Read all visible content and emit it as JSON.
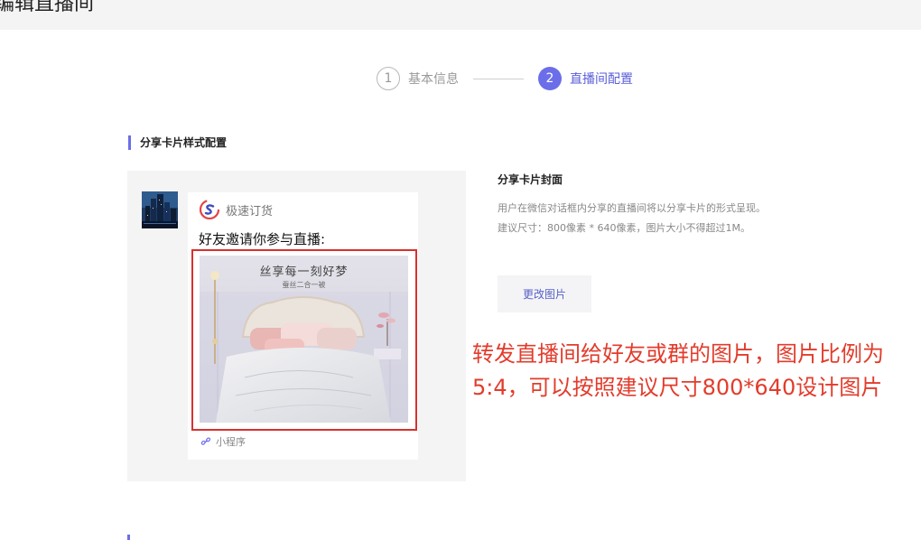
{
  "header": {
    "title": "编辑直播间"
  },
  "steps": [
    {
      "num": "1",
      "label": "基本信息",
      "state": "done"
    },
    {
      "num": "2",
      "label": "直播间配置",
      "state": "active"
    }
  ],
  "section": {
    "title": "分享卡片样式配置"
  },
  "preview": {
    "brand_name": "极速订货",
    "invite_text": "好友邀请你参与直播:",
    "cover_headline": "丝享每一刻好梦",
    "cover_subline": "蚕丝二合一被",
    "mini_program_label": "小程序"
  },
  "cover_setting": {
    "title": "分享卡片封面",
    "desc_line1": "用户在微信对话框内分享的直播间将以分享卡片的形式呈现。",
    "desc_line2": "建议尺寸：800像素 * 640像素，图片大小不得超过1M。",
    "change_button": "更改图片"
  },
  "annotation": {
    "text": "转发直播间给好友或群的图片，图片比例为5:4，可以按照建议尺寸800*640设计图片"
  },
  "colors": {
    "accent": "#6b6ee8",
    "annotation_red": "#e23c2c",
    "highlight_border": "#d83030"
  }
}
